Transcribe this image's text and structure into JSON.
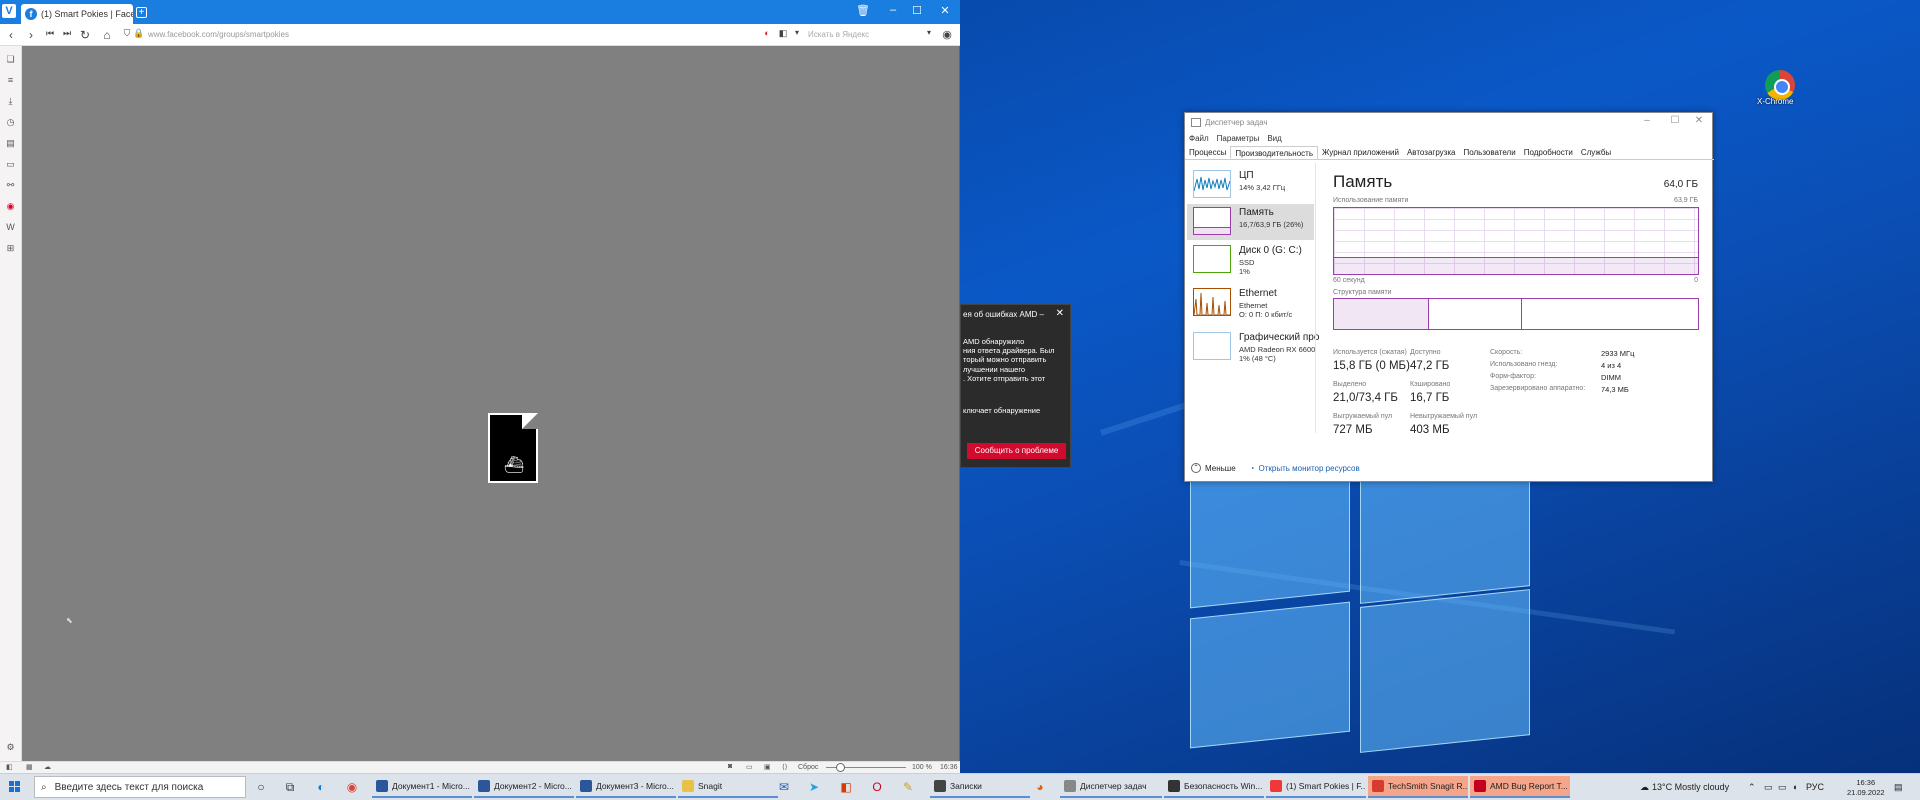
{
  "browser": {
    "tab_title": "(1) Smart Pokies | Facebook",
    "url": "www.facebook.com/groups/smartpokies",
    "search_placeholder": "Искать в Яндекс",
    "status_reset": "Сброс",
    "zoom": "100 %",
    "time": "16:36"
  },
  "amd_popup": {
    "title": "ея об ошибках AMD –",
    "body": "AMD обнаружило\nния ответа драйвера. Был\nторый можно отправить\nлучшении нашего\n. Хотите отправить этот",
    "body2": "ключает обнаружение",
    "report_button": "Сообщить о проблеме"
  },
  "task_manager": {
    "title": "Диспетчер задач",
    "menu": [
      "Файл",
      "Параметры",
      "Вид"
    ],
    "tabs": [
      "Процессы",
      "Производительность",
      "Журнал приложений",
      "Автозагрузка",
      "Пользователи",
      "Подробности",
      "Службы"
    ],
    "active_tab": 1,
    "perf_items": [
      {
        "name": "ЦП",
        "sub": [
          "14% 3,42 ГГц"
        ]
      },
      {
        "name": "Память",
        "sub": [
          "16,7/63,9 ГБ (26%)"
        ]
      },
      {
        "name": "Диск 0 (G: C:)",
        "sub": [
          "SSD",
          "1%"
        ]
      },
      {
        "name": "Ethernet",
        "sub": [
          "Ethernet",
          "О: 0 П: 0 кбит/с"
        ]
      },
      {
        "name": "Графический про",
        "sub": [
          "AMD Radeon RX 6600",
          "1% (48 °C)"
        ]
      }
    ],
    "memory": {
      "heading": "Память",
      "capacity": "64,0 ГБ",
      "usage_label": "Использование памяти",
      "usage_max": "63,9 ГБ",
      "usage_fraction": 0.26,
      "time_left": "60 секунд",
      "time_right": "0",
      "composition_label": "Структура памяти",
      "stats": [
        {
          "label": "Используется (сжатая)",
          "value": "15,8 ГБ (0 МБ)"
        },
        {
          "label": "Доступно",
          "value": "47,2 ГБ"
        },
        {
          "label": "Выделено",
          "value": "21,0/73,4 ГБ"
        },
        {
          "label": "Кэшировано",
          "value": "16,7 ГБ"
        },
        {
          "label": "Выгружаемый пул",
          "value": "727 МБ"
        },
        {
          "label": "Невыгружаемый пул",
          "value": "403 МБ"
        }
      ],
      "side_stats": [
        {
          "label": "Скорость:",
          "value": "2933 МГц"
        },
        {
          "label": "Использовано гнезд:",
          "value": "4 из 4"
        },
        {
          "label": "Форм-фактор:",
          "value": "DIMM"
        },
        {
          "label": "Зарезервировано аппаратно:",
          "value": "74,3 МБ"
        }
      ]
    },
    "fewer": "Меньше",
    "resource_monitor": "Открыть монитор ресурсов"
  },
  "desktop": {
    "chrome_label": "X-Chrome"
  },
  "taskbar": {
    "search_placeholder": "Введите здесь текст для поиска",
    "apps": [
      "Документ1 - Micro...",
      "Документ2 - Micro...",
      "Документ3 - Micro...",
      "Snagit",
      "Записки",
      "Диспетчер задач",
      "Безопасность Win...",
      "(1) Smart Pokies | F...",
      "TechSmith Snagit R...",
      "AMD Bug Report T..."
    ],
    "weather": "13°C  Mostly cloudy",
    "lang": "РУС",
    "time": "16:36",
    "date": "21.09.2022"
  }
}
